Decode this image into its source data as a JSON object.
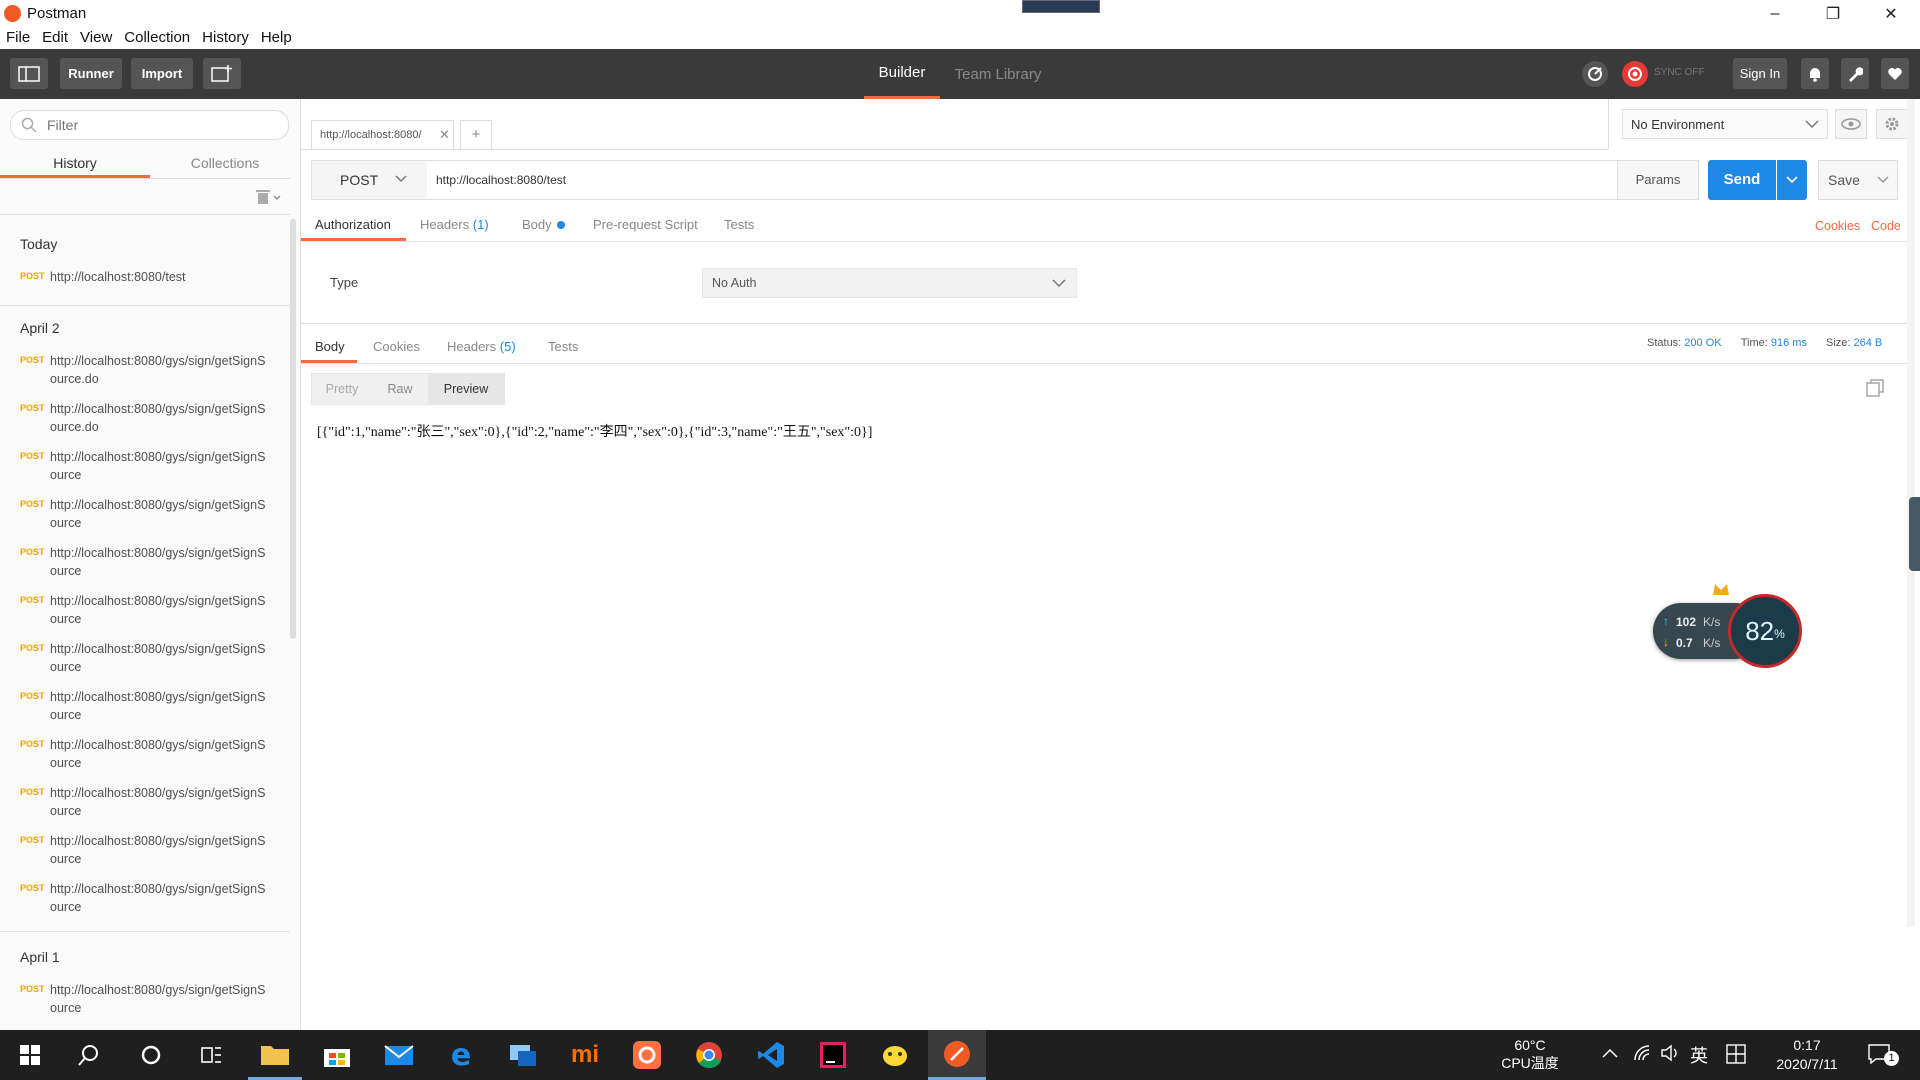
{
  "app": {
    "title": "Postman"
  },
  "menubar": [
    "File",
    "Edit",
    "View",
    "Collection",
    "History",
    "Help"
  ],
  "toolbar": {
    "runner": "Runner",
    "import": "Import",
    "tabs": [
      "Builder",
      "Team Library"
    ],
    "sync": "SYNC OFF",
    "sign_in": "Sign In"
  },
  "sidebar": {
    "filter_placeholder": "Filter",
    "tabs": [
      "History",
      "Collections"
    ],
    "groups": [
      {
        "label": "Today",
        "items": [
          {
            "method": "POST",
            "url": "http://localhost:8080/test"
          }
        ]
      },
      {
        "label": "April 2",
        "items": [
          {
            "method": "POST",
            "url": "http://localhost:8080/gys/sign/getSignSource.do"
          },
          {
            "method": "POST",
            "url": "http://localhost:8080/gys/sign/getSignSource.do"
          },
          {
            "method": "POST",
            "url": "http://localhost:8080/gys/sign/getSignSource"
          },
          {
            "method": "POST",
            "url": "http://localhost:8080/gys/sign/getSignSource"
          },
          {
            "method": "POST",
            "url": "http://localhost:8080/gys/sign/getSignSource"
          },
          {
            "method": "POST",
            "url": "http://localhost:8080/gys/sign/getSignSource"
          },
          {
            "method": "POST",
            "url": "http://localhost:8080/gys/sign/getSignSource"
          },
          {
            "method": "POST",
            "url": "http://localhost:8080/gys/sign/getSignSource"
          },
          {
            "method": "POST",
            "url": "http://localhost:8080/gys/sign/getSignSource"
          },
          {
            "method": "POST",
            "url": "http://localhost:8080/gys/sign/getSignSource"
          },
          {
            "method": "POST",
            "url": "http://localhost:8080/gys/sign/getSignSource"
          },
          {
            "method": "POST",
            "url": "http://localhost:8080/gys/sign/getSignSource"
          }
        ]
      },
      {
        "label": "April 1",
        "items": [
          {
            "method": "POST",
            "url": "http://localhost:8080/gys/sign/getSignSource"
          }
        ]
      }
    ]
  },
  "request": {
    "tab_title": "http://localhost:8080/",
    "environment": "No Environment",
    "method": "POST",
    "url": "http://localhost:8080/test",
    "params": "Params",
    "send": "Send",
    "save": "Save",
    "subtabs": {
      "authorization": "Authorization",
      "headers": "Headers",
      "headers_count": "(1)",
      "body": "Body",
      "prerequest": "Pre-request Script",
      "tests": "Tests"
    },
    "cookies": "Cookies",
    "code": "Code",
    "auth_type_label": "Type",
    "auth_type_value": "No Auth"
  },
  "response": {
    "tabs": {
      "body": "Body",
      "cookies": "Cookies",
      "headers": "Headers",
      "headers_count": "(5)",
      "tests": "Tests"
    },
    "status_label": "Status:",
    "status_value": "200 OK",
    "time_label": "Time:",
    "time_value": "916 ms",
    "size_label": "Size:",
    "size_value": "264 B",
    "view_modes": [
      "Pretty",
      "Raw",
      "Preview"
    ],
    "body": "[{\"id\":1,\"name\":\"张三\",\"sex\":0},{\"id\":2,\"name\":\"李四\",\"sex\":0},{\"id\":3,\"name\":\"王五\",\"sex\":0}]"
  },
  "net_widget": {
    "up": "102",
    "down": "0.7",
    "unit": "K/s",
    "percent": "82",
    "percent_sign": "%"
  },
  "taskbar": {
    "cpu_temp": "60°C",
    "cpu_label": "CPU温度",
    "ime": "英",
    "time": "0:17",
    "date": "2020/7/11",
    "notifications": "1"
  },
  "colors": {
    "accent": "#f26b3a",
    "send": "#1e88e5",
    "toolbar": "#3a3a3a",
    "taskbar": "#1f1f1f"
  }
}
